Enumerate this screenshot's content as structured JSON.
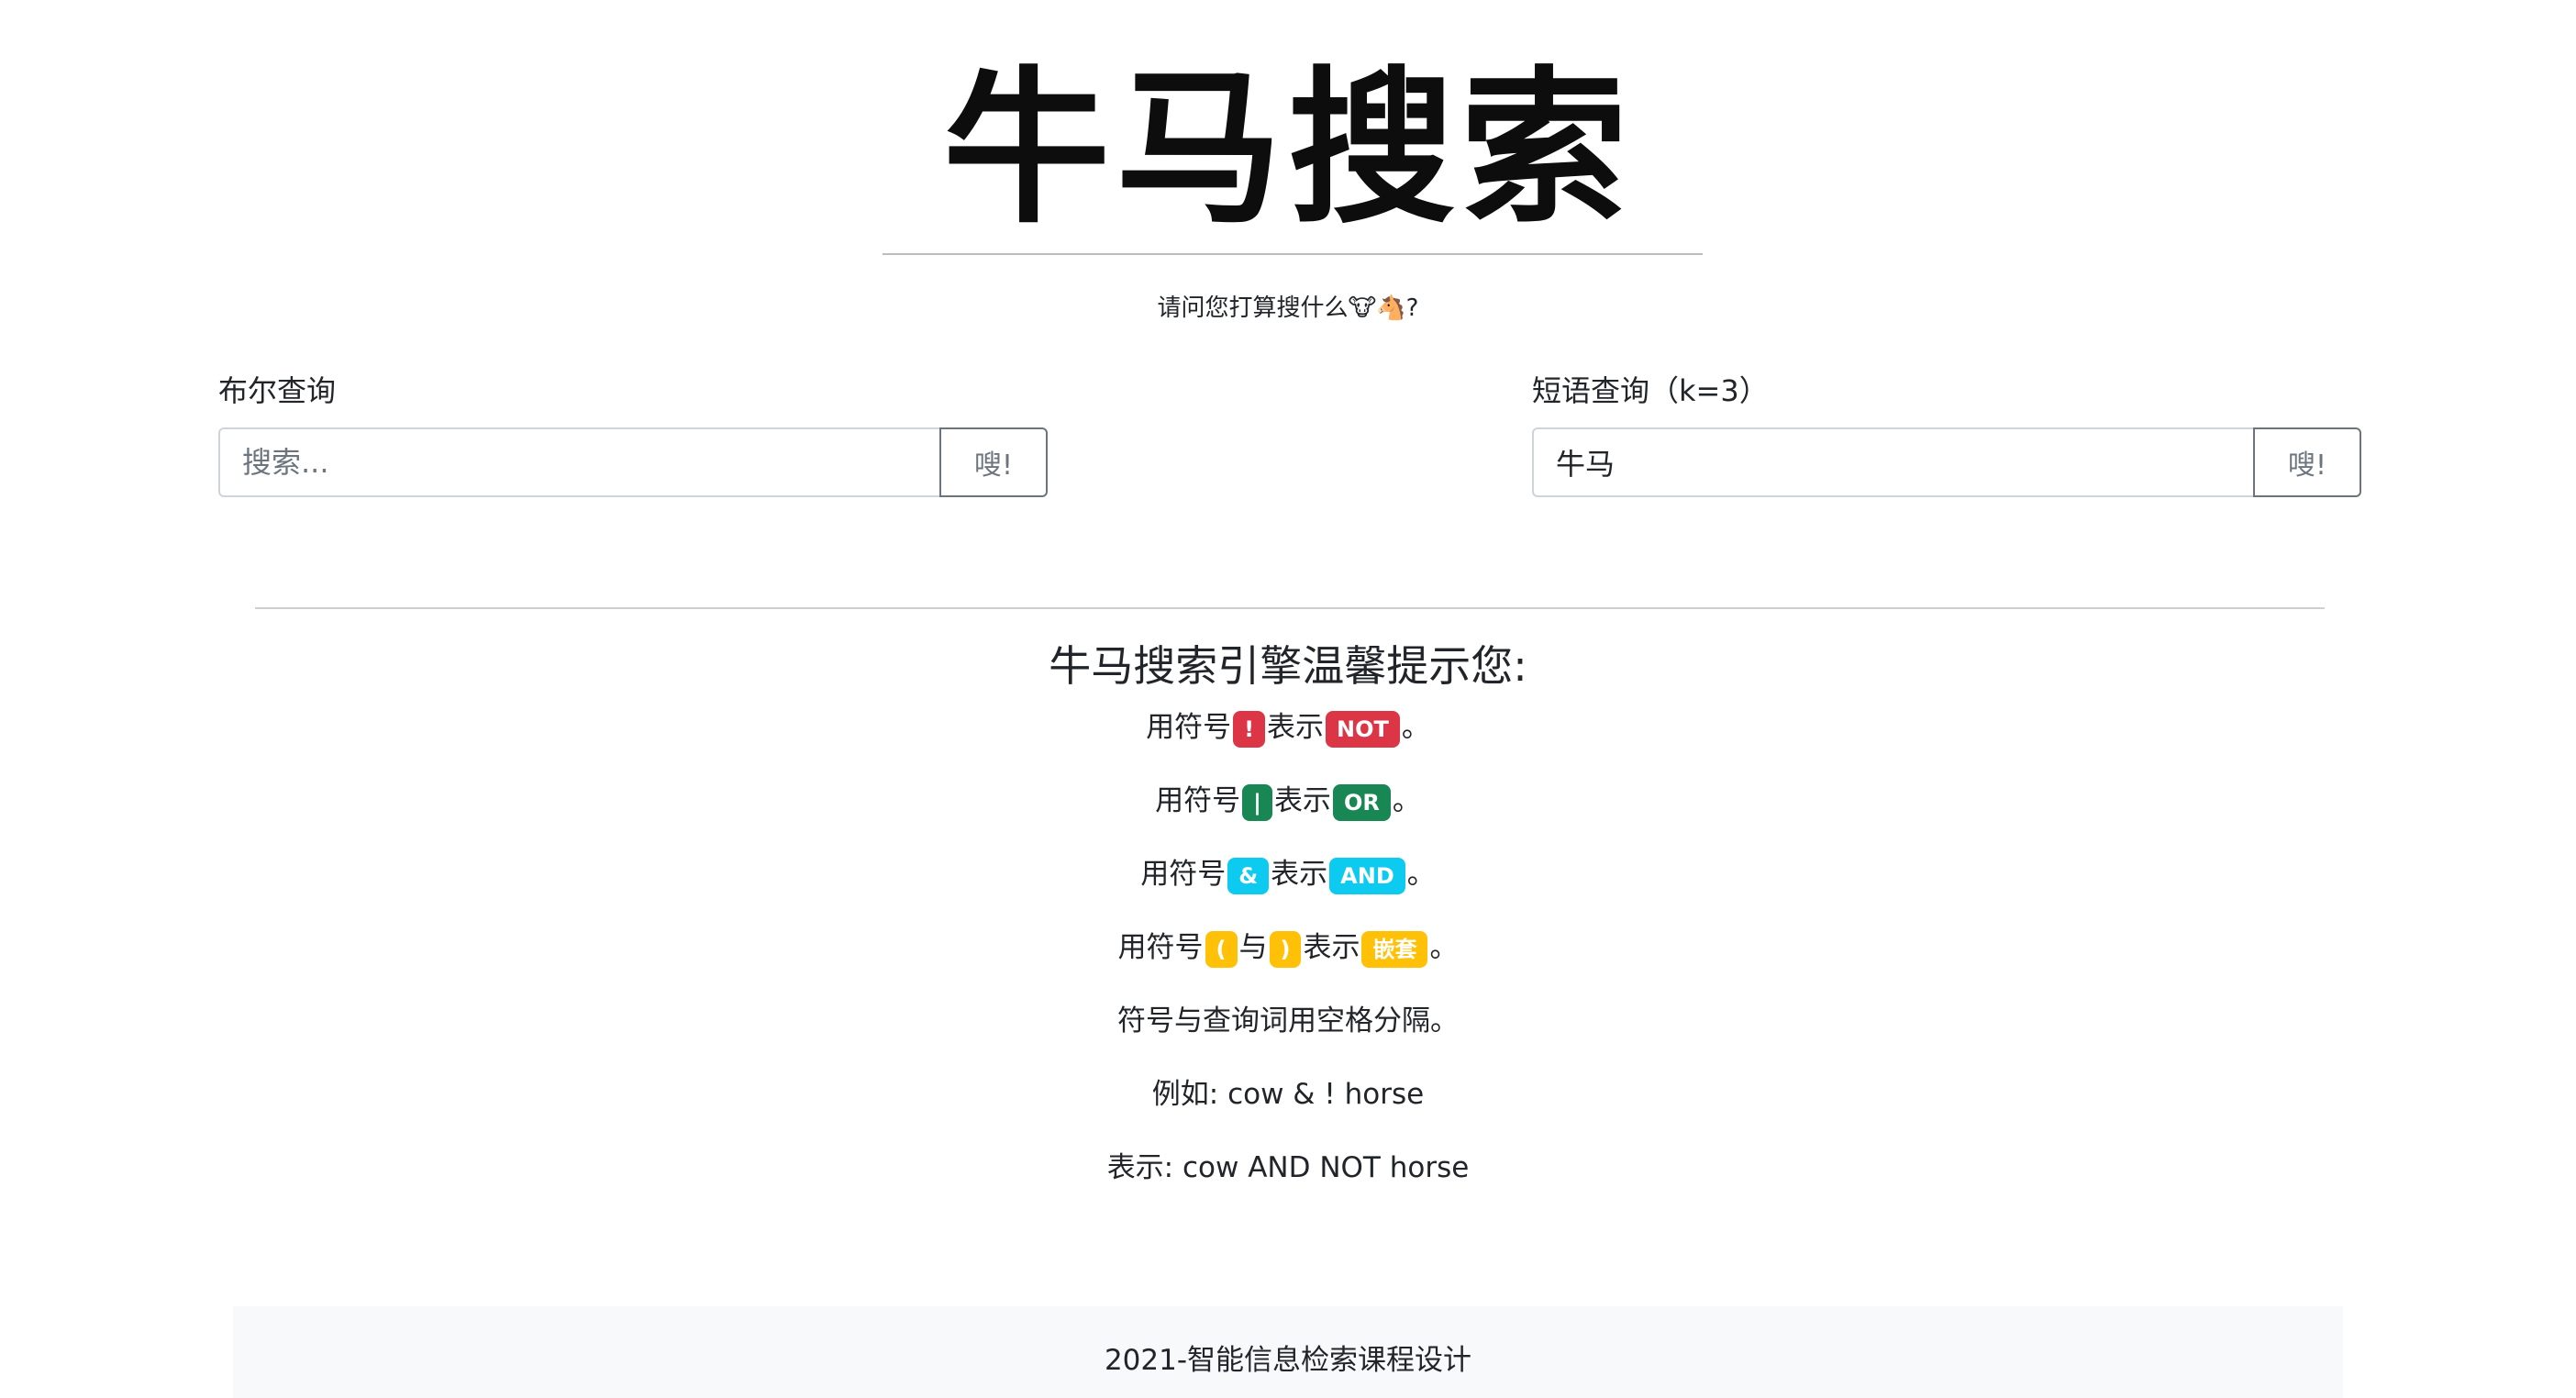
{
  "logo": "牛马搜索",
  "prompt": "请问您打算搜什么🐮🐴?",
  "boolean_query": {
    "label": "布尔查询",
    "placeholder": "搜索...",
    "value": "",
    "button": "嗖!"
  },
  "phrase_query": {
    "label": "短语查询（k=3）",
    "placeholder": "",
    "value": "牛马",
    "button": "嗖!"
  },
  "tips": {
    "title": "牛马搜索引擎温馨提示您:",
    "lines": [
      {
        "prefix": "用符号",
        "symbol": "!",
        "mid": "表示",
        "meaning": "NOT",
        "suffix": "。"
      },
      {
        "prefix": "用符号",
        "symbol": "|",
        "mid": "表示",
        "meaning": "OR",
        "suffix": "。"
      },
      {
        "prefix": "用符号",
        "symbol": "&",
        "mid": "表示",
        "meaning": "AND",
        "suffix": "。"
      },
      {
        "prefix": "用符号",
        "symbol": "(",
        "and": "与",
        "symbol2": ")",
        "mid": "表示",
        "meaning": "嵌套",
        "suffix": "。"
      }
    ],
    "separator_note": "符号与查询词用空格分隔。",
    "example": "例如: cow & ! horse",
    "meaning_example": "表示: cow AND NOT horse"
  },
  "colors": {
    "not": "#dc3545",
    "or": "#198754",
    "and": "#0dcaf0",
    "nest": "#ffc107"
  },
  "footer": "2021-智能信息检索课程设计"
}
